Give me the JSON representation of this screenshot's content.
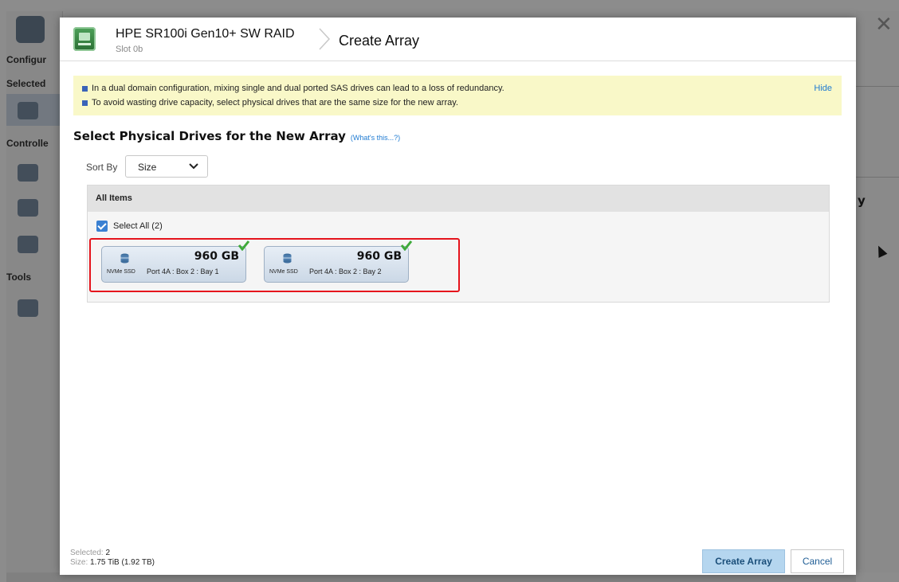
{
  "header": {
    "controller_name": "HPE SR100i Gen10+ SW RAID",
    "controller_slot": "Slot 0b",
    "page_title": "Create Array"
  },
  "notice": {
    "messages": [
      "In a dual domain configuration, mixing single and dual ported SAS drives can lead to a loss of redundancy.",
      "To avoid wasting drive capacity, select physical drives that are the same size for the new array."
    ],
    "hide_label": "Hide"
  },
  "section": {
    "title": "Select Physical Drives for the New Array",
    "help_link": "(What's this...?)"
  },
  "sort": {
    "label": "Sort By",
    "selected": "Size"
  },
  "panel": {
    "header": "All Items",
    "select_all_label": "Select All (2)",
    "select_all_checked": true
  },
  "drives": [
    {
      "size": "960 GB",
      "type": "NVMe SSD",
      "location": "Port 4A : Box 2 : Bay 1",
      "selected": true
    },
    {
      "size": "960 GB",
      "type": "NVMe SSD",
      "location": "Port 4A : Box 2 : Bay 2",
      "selected": true
    }
  ],
  "footer": {
    "selected_label": "Selected:",
    "selected_value": "2",
    "size_label": "Size:",
    "size_value": "1.75 TiB (1.92 TB)",
    "create_label": "Create Array",
    "cancel_label": "Cancel"
  },
  "background": {
    "sidebar_headings": [
      "Configur",
      "Selected",
      "Controlle",
      "Tools"
    ]
  },
  "colors": {
    "accent": "#1f7bd2",
    "notice_bg": "#f9f8c8",
    "selection_frame": "#e5141c",
    "check_green": "#3fa93a"
  }
}
